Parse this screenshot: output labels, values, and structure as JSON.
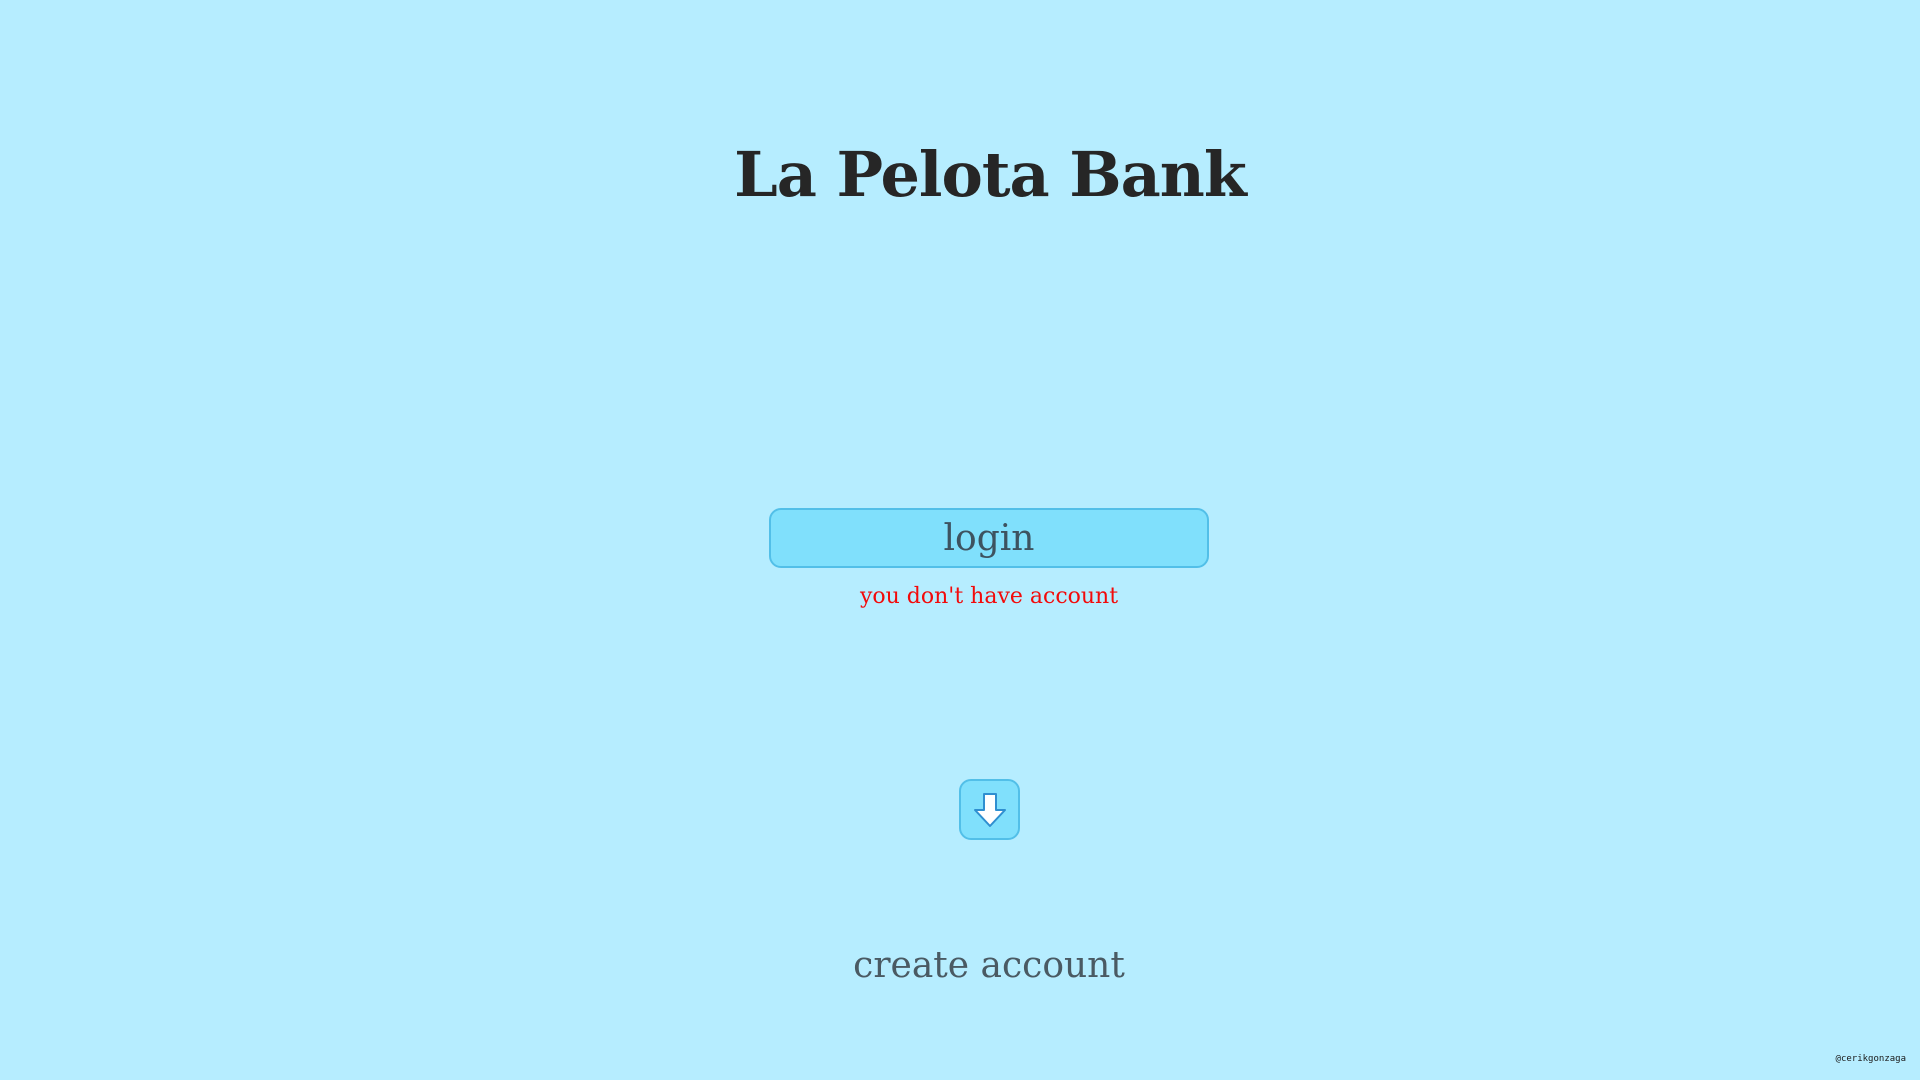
{
  "header": {
    "title": "La Pelota Bank"
  },
  "auth": {
    "login_label": "login",
    "error_message": "you don't have account",
    "create_account_label": "create account"
  },
  "icons": {
    "down_button_icon": "arrow-down-icon"
  },
  "footer": {
    "credit": "@cerikgonzaga"
  },
  "colors": {
    "background": "#b6edff",
    "button_fill": "#80e0fc",
    "button_border": "#52bfe8",
    "error": "#f20a0a",
    "title": "#262626"
  }
}
